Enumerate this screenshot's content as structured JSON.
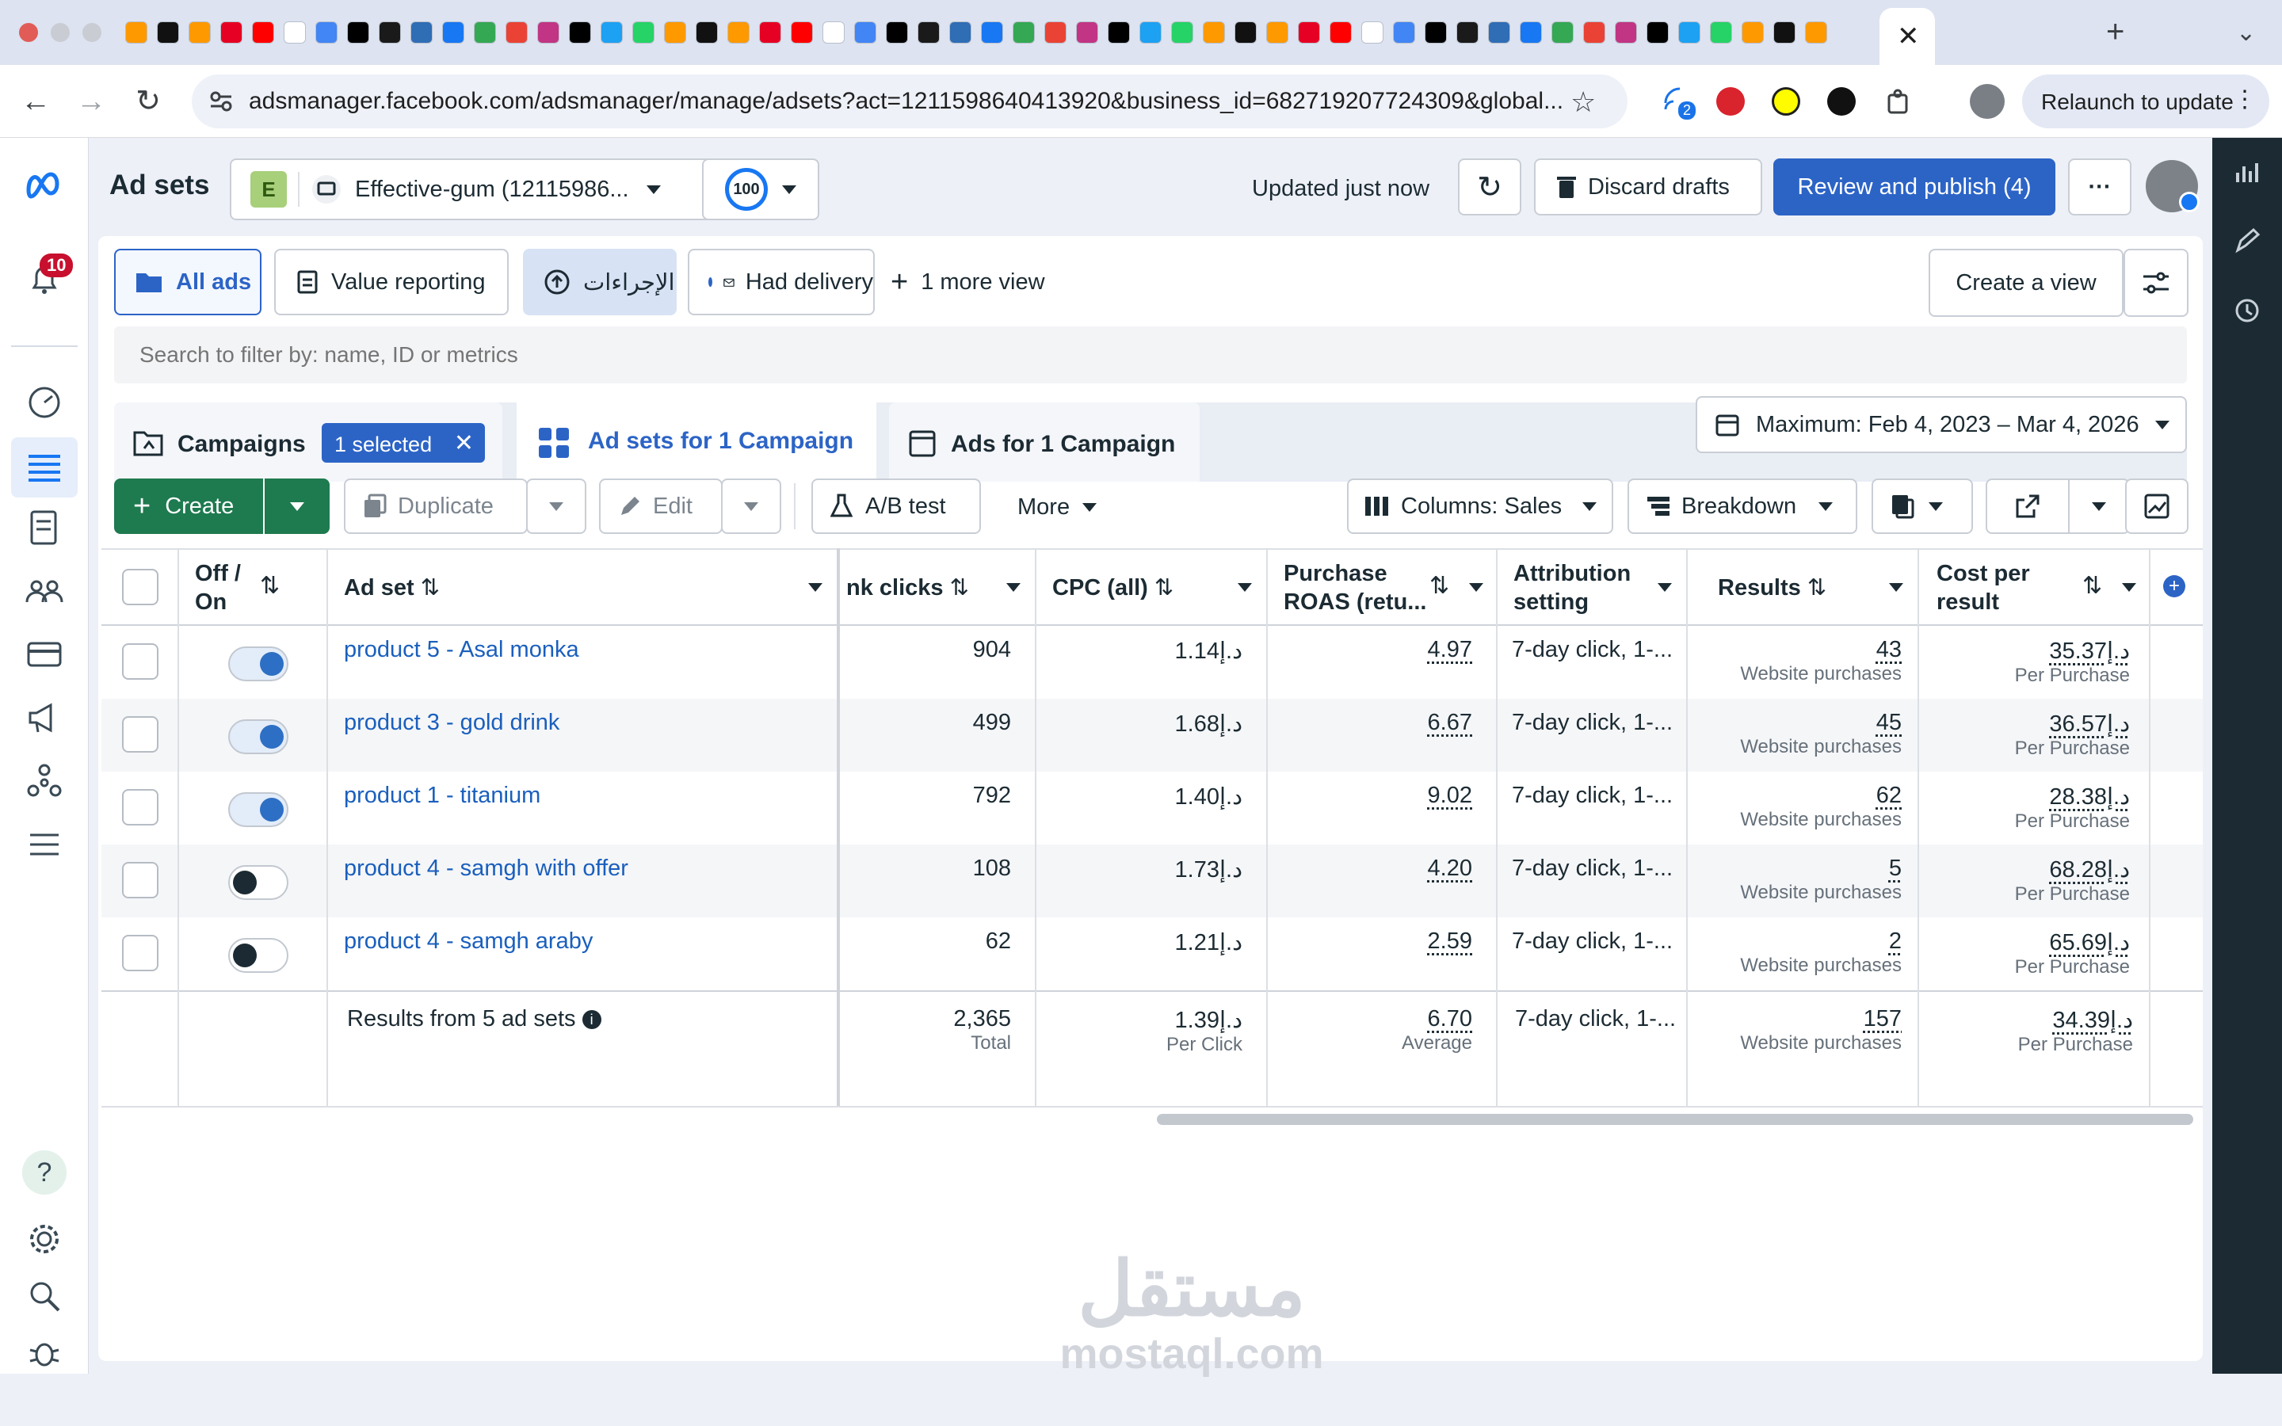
{
  "browser": {
    "address_url": "adsmanager.facebook.com/adsmanager/manage/adsets?act=1211598640413920&business_id=682719207724309&global...",
    "relaunch_label": "Relaunch to update",
    "extension_badge": "2"
  },
  "nav": {
    "notifications_badge": "10",
    "help_label": "?"
  },
  "header": {
    "title": "Ad sets",
    "account_initial": "E",
    "account_name": "Effective-gum (12115986...",
    "score": "100",
    "updated": "Updated just now",
    "discard": "Discard drafts",
    "publish": "Review and publish (4)",
    "more": "···"
  },
  "views": {
    "all_ads": "All ads",
    "value_reporting": "Value reporting",
    "actions": "الإجراءات",
    "had_delivery": "Had delivery",
    "more_view": "1 more view",
    "create_view": "Create a view"
  },
  "search": {
    "placeholder": "Search to filter by: name, ID or metrics"
  },
  "tabs": {
    "campaigns": "Campaigns",
    "selected": "1 selected",
    "adsets": "Ad sets for 1 Campaign",
    "ads": "Ads for 1 Campaign",
    "date_range": "Maximum: Feb 4, 2023 – Mar 4, 2026"
  },
  "toolbar": {
    "create": "Create",
    "duplicate": "Duplicate",
    "edit": "Edit",
    "ab_test": "A/B test",
    "more": "More",
    "columns": "Columns: Sales",
    "breakdown": "Breakdown"
  },
  "table": {
    "headers": {
      "offon": [
        "Off /",
        "On"
      ],
      "adset": "Ad set",
      "link_clicks": "nk clicks",
      "cpc": "CPC (all)",
      "roas": [
        "Purchase",
        "ROAS (retu..."
      ],
      "attribution": [
        "Attribution",
        "setting"
      ],
      "results": "Results",
      "cost": [
        "Cost per",
        "result"
      ]
    },
    "rows": [
      {
        "on": true,
        "name": "product 5 - Asal monka",
        "clicks": "904",
        "cpc": "د.إ1.14",
        "roas": "4.97",
        "attr": "7-day click, 1-...",
        "results": "43",
        "results_sub": "Website purchases",
        "cost": "د.إ35.37",
        "cost_sub": "Per Purchase"
      },
      {
        "on": true,
        "name": "product 3 - gold drink",
        "clicks": "499",
        "cpc": "د.إ1.68",
        "roas": "6.67",
        "attr": "7-day click, 1-...",
        "results": "45",
        "results_sub": "Website purchases",
        "cost": "د.إ36.57",
        "cost_sub": "Per Purchase"
      },
      {
        "on": true,
        "name": "product 1 - titanium",
        "clicks": "792",
        "cpc": "د.إ1.40",
        "roas": "9.02",
        "attr": "7-day click, 1-...",
        "results": "62",
        "results_sub": "Website purchases",
        "cost": "د.إ28.38",
        "cost_sub": "Per Purchase"
      },
      {
        "on": false,
        "name": "product 4 - samgh with offer",
        "clicks": "108",
        "cpc": "د.إ1.73",
        "roas": "4.20",
        "attr": "7-day click, 1-...",
        "results": "5",
        "results_sub": "Website purchases",
        "cost": "د.إ68.28",
        "cost_sub": "Per Purchase"
      },
      {
        "on": false,
        "name": "product 4 - samgh araby",
        "clicks": "62",
        "cpc": "د.إ1.21",
        "roas": "2.59",
        "attr": "7-day click, 1-...",
        "results": "2",
        "results_sub": "Website purchases",
        "cost": "د.إ65.69",
        "cost_sub": "Per Purchase"
      }
    ],
    "totals": {
      "label": "Results from 5 ad sets",
      "clicks": "2,365",
      "clicks_sub": "Total",
      "cpc": "د.إ1.39",
      "cpc_sub": "Per Click",
      "roas": "6.70",
      "roas_sub": "Average",
      "attr": "7-day click, 1-...",
      "results": "157",
      "results_sub": "Website purchases",
      "cost": "د.إ34.39",
      "cost_sub": "Per Purchase"
    }
  },
  "watermark": {
    "arabic": "مستقل",
    "latin": "mostaql.com"
  },
  "colors": {
    "primary": "#1877f2",
    "link": "#1a5fbd",
    "toggle_on": "#2d6fc4",
    "toggle_off": "#1c2b33",
    "create_green": "#1e7a4f",
    "badge_red": "#c8102e"
  }
}
